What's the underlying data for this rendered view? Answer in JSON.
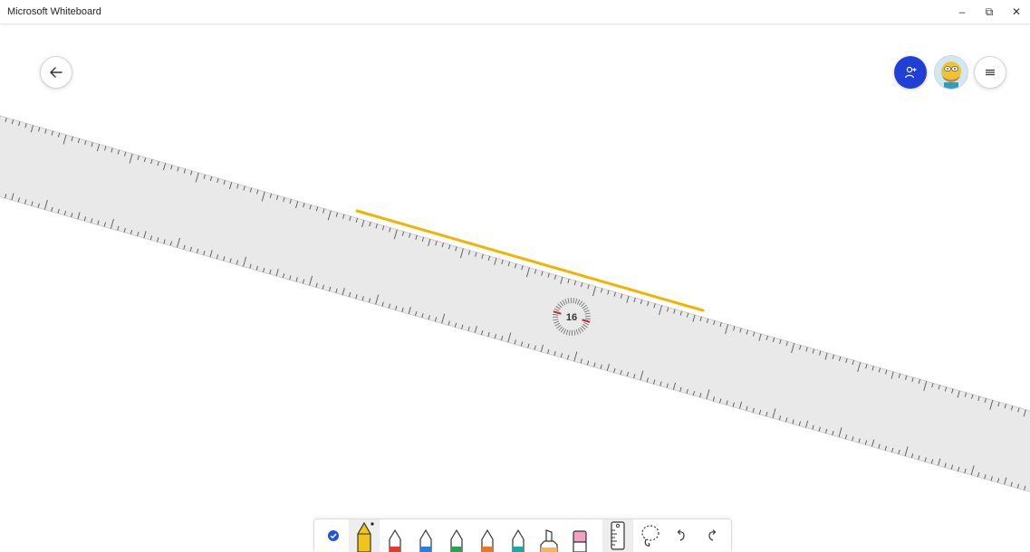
{
  "window": {
    "title": "Microsoft Whiteboard",
    "minimize_glyph": "–",
    "restore_glyph": "⧉",
    "close_glyph": "✕"
  },
  "canvas": {
    "back_icon": "arrow-left-icon",
    "invite_icon": "add-person-icon",
    "avatar_icon": "user-avatar-icon",
    "menu_icon": "hamburger-menu-icon",
    "ruler_angle": "16",
    "ink_stroke_color": "#f0b400"
  },
  "toolbar": {
    "tools": [
      {
        "name": "select-tool",
        "icon": "checkmark-circle-icon",
        "color": "#1f55d6"
      },
      {
        "name": "pen-yellow",
        "icon": "pen-icon",
        "color": "#f0c419",
        "selected": true
      },
      {
        "name": "pen-red",
        "icon": "pen-icon",
        "color": "#e03c31"
      },
      {
        "name": "pen-blue",
        "icon": "pen-icon",
        "color": "#2a7de1"
      },
      {
        "name": "pen-green",
        "icon": "pen-icon",
        "color": "#2f9e57"
      },
      {
        "name": "pen-orange",
        "icon": "pen-icon",
        "color": "#e8782a"
      },
      {
        "name": "pen-teal",
        "icon": "pen-icon",
        "color": "#21a6a6"
      },
      {
        "name": "highlighter",
        "icon": "highlighter-icon",
        "color": "#f6b35c"
      },
      {
        "name": "eraser",
        "icon": "eraser-icon",
        "color": "#f2a3c4"
      },
      {
        "name": "ruler",
        "icon": "ruler-icon",
        "color": "#444444"
      },
      {
        "name": "lasso",
        "icon": "lasso-icon",
        "color": "#444444"
      },
      {
        "name": "undo",
        "icon": "undo-icon",
        "color": "#444444"
      },
      {
        "name": "redo",
        "icon": "redo-icon",
        "color": "#444444"
      }
    ]
  }
}
